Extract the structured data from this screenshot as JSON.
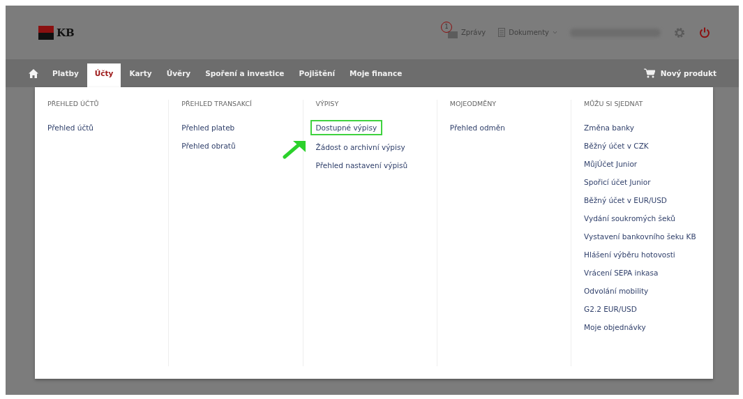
{
  "header": {
    "logo": "KB",
    "messages": {
      "count": "1",
      "label": "Zprávy"
    },
    "documents": {
      "label": "Dokumenty"
    }
  },
  "nav": {
    "tabs": [
      {
        "label": "Platby",
        "selected": false
      },
      {
        "label": "Účty",
        "selected": true
      },
      {
        "label": "Karty",
        "selected": false
      },
      {
        "label": "Úvěry",
        "selected": false
      },
      {
        "label": "Spoření a investice",
        "selected": false
      },
      {
        "label": "Pojištění",
        "selected": false
      },
      {
        "label": "Moje finance",
        "selected": false
      }
    ],
    "new_product": "Nový produkt"
  },
  "menu": {
    "columns": [
      {
        "heading": "PŘEHLED ÚČTŮ",
        "items": [
          {
            "label": "Přehled účtů",
            "highlighted": false
          }
        ]
      },
      {
        "heading": "PŘEHLED TRANSAKCÍ",
        "items": [
          {
            "label": "Přehled plateb",
            "highlighted": false
          },
          {
            "label": "Přehled obratů",
            "highlighted": false
          }
        ]
      },
      {
        "heading": "VÝPISY",
        "items": [
          {
            "label": "Dostupné výpisy",
            "highlighted": true
          },
          {
            "label": "Žádost o archivní výpisy",
            "highlighted": false
          },
          {
            "label": "Přehled nastavení výpisů",
            "highlighted": false
          }
        ]
      },
      {
        "heading": "MOJEODMĚNY",
        "items": [
          {
            "label": "Přehled odměn",
            "highlighted": false
          }
        ]
      },
      {
        "heading": "MŮŽU SI SJEDNAT",
        "items": [
          {
            "label": "Změna banky",
            "highlighted": false
          },
          {
            "label": "Běžný účet v CZK",
            "highlighted": false
          },
          {
            "label": "MůjÚčet Junior",
            "highlighted": false
          },
          {
            "label": "Spořicí účet Junior",
            "highlighted": false
          },
          {
            "label": "Běžný účet v EUR/USD",
            "highlighted": false
          },
          {
            "label": "Vydání soukromých šeků",
            "highlighted": false
          },
          {
            "label": "Vystavení bankovního šeku KB",
            "highlighted": false
          },
          {
            "label": "Hlášení výběru hotovosti",
            "highlighted": false
          },
          {
            "label": "Vrácení SEPA inkasa",
            "highlighted": false
          },
          {
            "label": "Odvolání mobility",
            "highlighted": false
          },
          {
            "label": "G2.2 EUR/USD",
            "highlighted": false
          },
          {
            "label": "Moje objednávky",
            "highlighted": false
          }
        ]
      }
    ]
  }
}
